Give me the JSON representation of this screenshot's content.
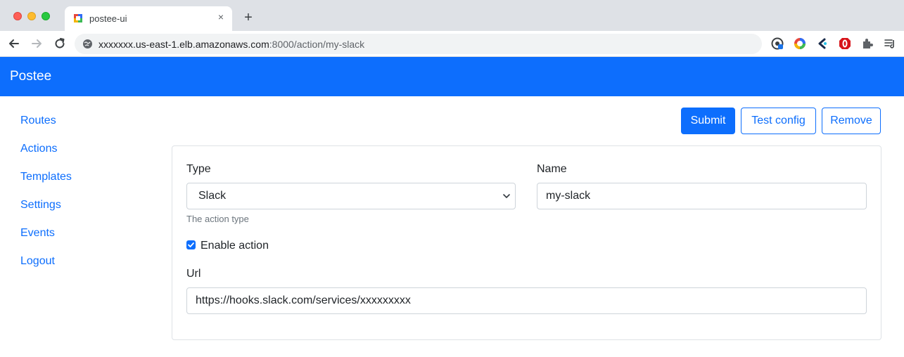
{
  "browser": {
    "tab_title": "postee-ui",
    "tab_close": "×",
    "new_tab": "+",
    "url_host": "xxxxxxx.us-east-1.elb.amazonaws.com",
    "url_rest": ":8000/action/my-slack"
  },
  "app": {
    "brand": "Postee"
  },
  "sidebar": {
    "items": [
      {
        "label": "Routes"
      },
      {
        "label": "Actions"
      },
      {
        "label": "Templates"
      },
      {
        "label": "Settings"
      },
      {
        "label": "Events"
      },
      {
        "label": "Logout"
      }
    ]
  },
  "actions_bar": {
    "submit": "Submit",
    "test_config": "Test config",
    "remove": "Remove"
  },
  "form": {
    "type_label": "Type",
    "type_value": "Slack",
    "type_help": "The action type",
    "name_label": "Name",
    "name_value": "my-slack",
    "enable_label": "Enable action",
    "enable_checked": true,
    "url_label": "Url",
    "url_value": "https://hooks.slack.com/services/xxxxxxxxx"
  },
  "colors": {
    "primary": "#0d6efd",
    "text": "#212529",
    "muted": "#6c757d"
  }
}
